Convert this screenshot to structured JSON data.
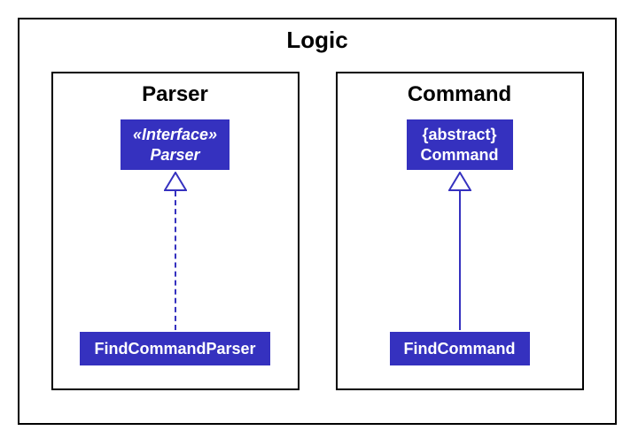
{
  "diagram": {
    "outer_title": "Logic",
    "packages": {
      "parser": {
        "title": "Parser",
        "top": {
          "stereotype": "«Interface»",
          "name": "Parser"
        },
        "bottom": {
          "name": "FindCommandParser"
        },
        "relation": "realization"
      },
      "command": {
        "title": "Command",
        "top": {
          "stereotype": "{abstract}",
          "name": "Command"
        },
        "bottom": {
          "name": "FindCommand"
        },
        "relation": "generalization"
      }
    }
  }
}
